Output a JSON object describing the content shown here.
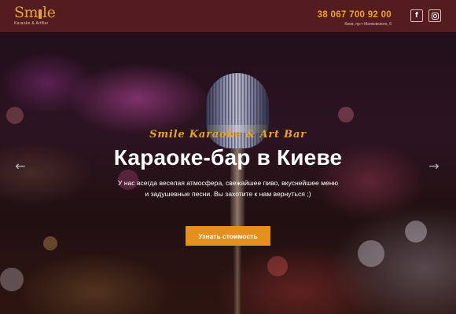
{
  "header": {
    "logo_text": "Sm",
    "logo_text_end": "le",
    "logo_subtitle": "Karaoke & ArtBar",
    "phone": "38 067 700 92 00",
    "address": "Киев, пр-т Маяковского, 6",
    "social": [
      {
        "name": "facebook",
        "icon": "facebook-icon",
        "glyph": "f"
      },
      {
        "name": "instagram",
        "icon": "instagram-icon"
      }
    ]
  },
  "hero": {
    "tagline": "Smile Karaoke & Art Bar",
    "title": "Караоке-бар в Киеве",
    "description_line1": "У нас всегда веселая атмосфера, свежайшее пиво, вкуснейшее меню",
    "description_line2": "и задушевные песни. Вы захотите к нам вернуться ;)",
    "cta_label": "Узнать стоимость",
    "prev_icon": "arrow-left-icon",
    "next_icon": "arrow-right-icon"
  },
  "colors": {
    "header_bg": "#551c20",
    "accent": "#e6a23a",
    "cta_bg": "#e3901c"
  }
}
